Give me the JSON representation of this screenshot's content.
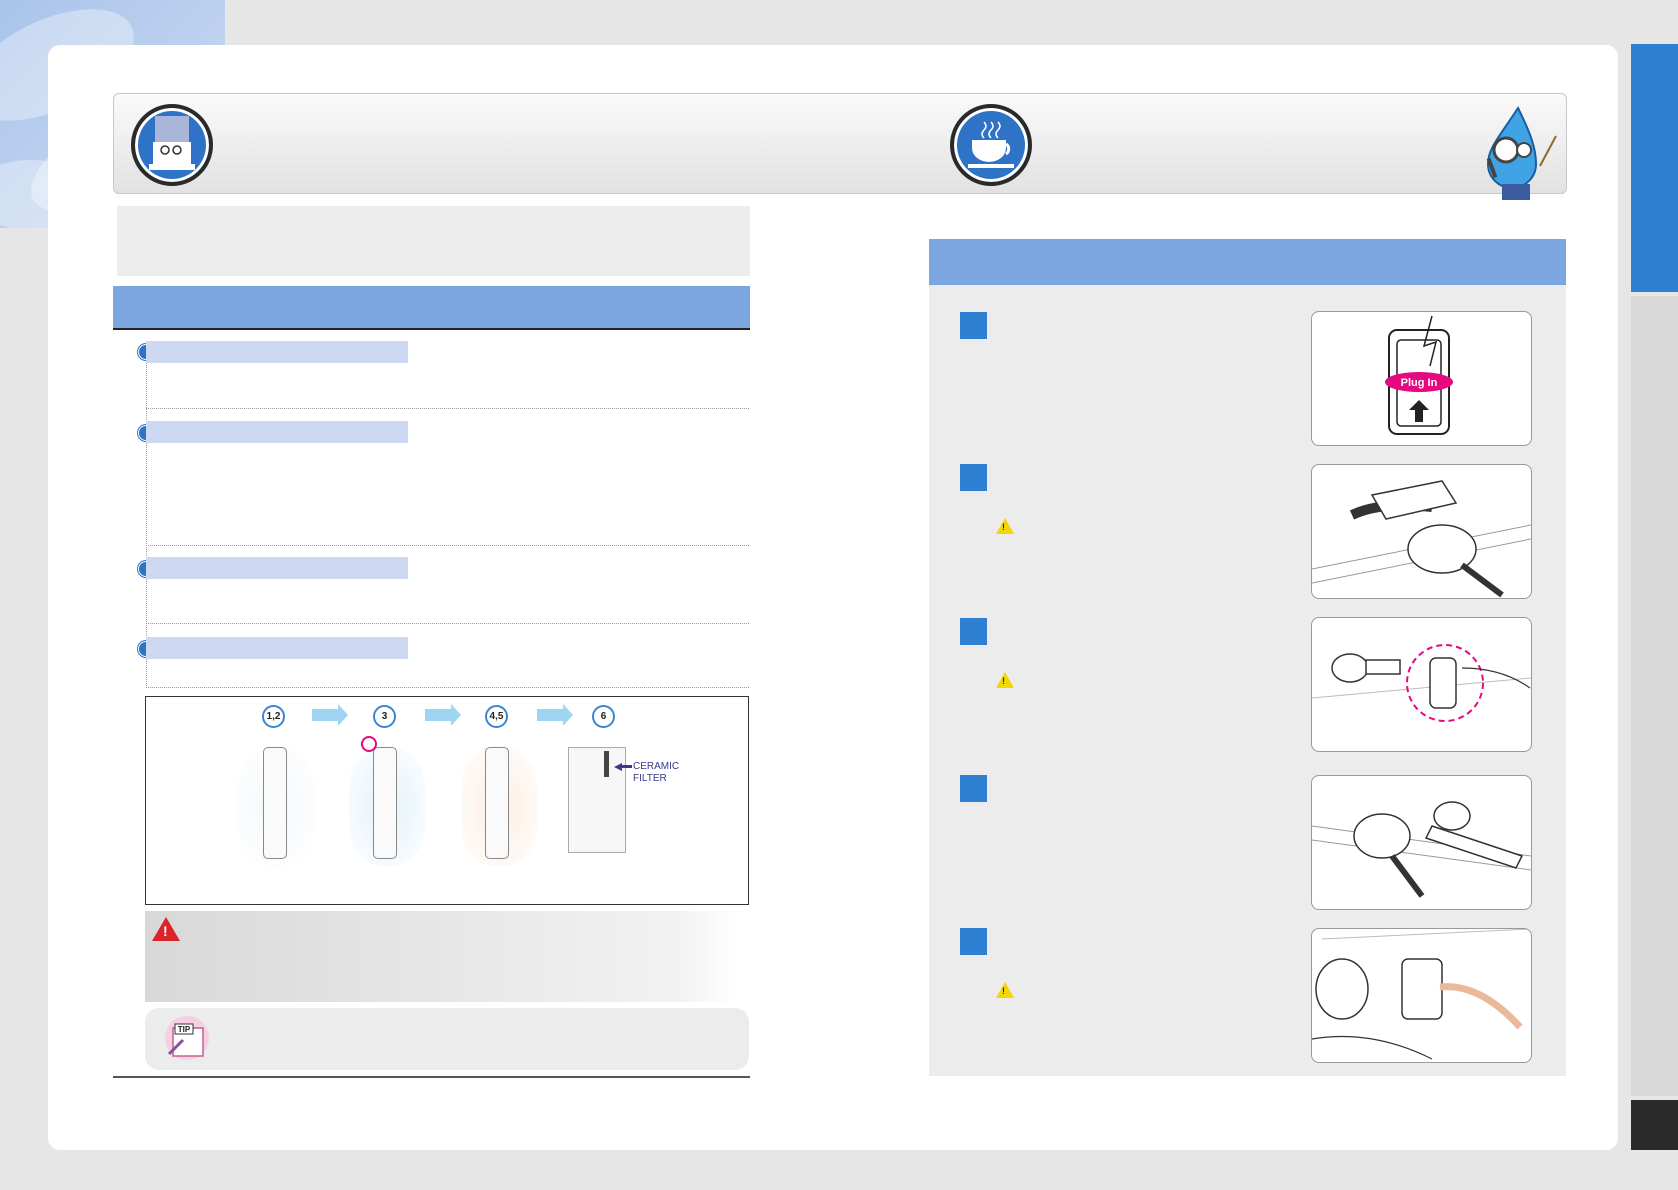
{
  "diagram": {
    "steps": [
      "1,2",
      "3",
      "4,5",
      "6"
    ],
    "ceramic_label_line1": "CERAMIC",
    "ceramic_label_line2": "FILTER"
  },
  "tip": {
    "badge": "TIP"
  },
  "right": {
    "install_images": [
      {
        "name": "plug-in",
        "label": "Plug In"
      },
      {
        "name": "wrench-on-faucet"
      },
      {
        "name": "adapter-in-hand"
      },
      {
        "name": "wrench-tighten"
      },
      {
        "name": "hose-connect"
      }
    ]
  },
  "colors": {
    "accent_blue": "#2f7fd3",
    "section_bar": "#7ba6e0",
    "item_bar": "#cdd9f3",
    "warning_red": "#d9242a",
    "caution_yellow": "#f2d800",
    "plug_in_magenta": "#e5087f"
  }
}
